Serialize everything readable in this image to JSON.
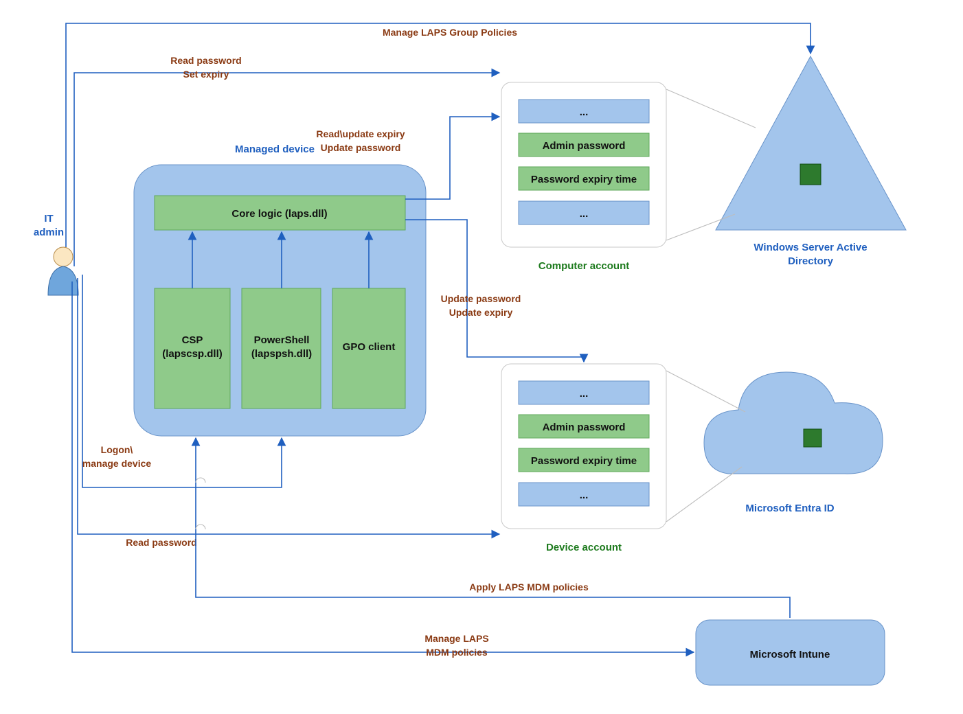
{
  "actor": {
    "label1": "IT",
    "label2": "admin"
  },
  "managed_device": {
    "title": "Managed device",
    "core": "Core logic (laps.dll)",
    "mods": [
      {
        "l1": "CSP",
        "l2": "(lapscsp.dll)"
      },
      {
        "l1": "PowerShell",
        "l2": "(lapspsh.dll)"
      },
      {
        "l1": "GPO client",
        "l2": ""
      }
    ]
  },
  "computer_account": {
    "title": "Computer account",
    "rows": [
      "...",
      "Admin password",
      "Password expiry time",
      "..."
    ]
  },
  "device_account": {
    "title": "Device account",
    "rows": [
      "...",
      "Admin password",
      "Password expiry time",
      "..."
    ]
  },
  "ad": {
    "l1": "Windows Server Active",
    "l2": "Directory"
  },
  "entra": {
    "l1": "Microsoft Entra ID"
  },
  "intune": {
    "l1": "Microsoft Intune"
  },
  "labels": {
    "manage_gp": "Manage LAPS Group Policies",
    "read_set1": "Read password",
    "read_set2": "Set expiry",
    "readupd1": "Read\\update expiry",
    "readupd2": "Update password",
    "upd1": "Update password",
    "upd2": "Update expiry",
    "logon1": "Logon\\",
    "logon2": "manage device",
    "read_pw": "Read password",
    "apply_mdm": "Apply LAPS MDM policies",
    "manage_mdm1": "Manage LAPS",
    "manage_mdm2": "MDM policies"
  }
}
